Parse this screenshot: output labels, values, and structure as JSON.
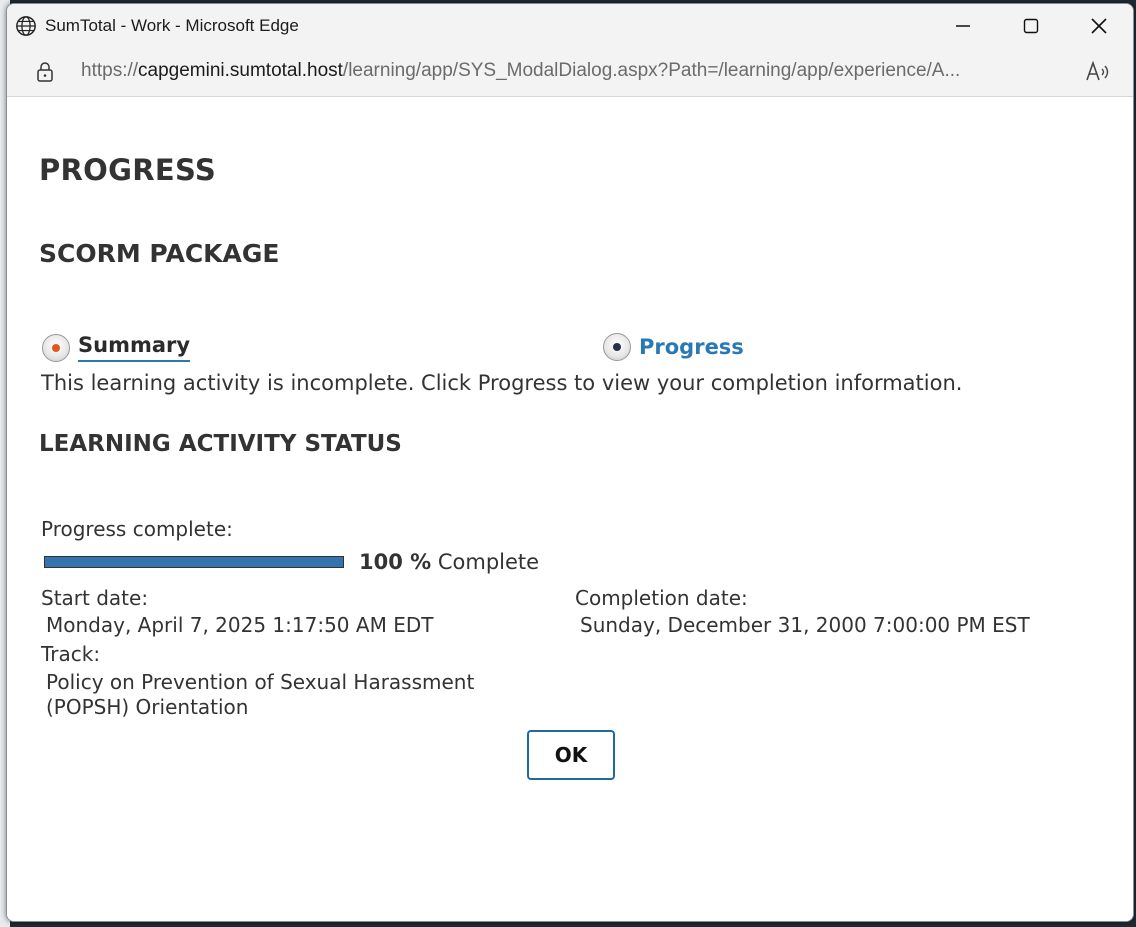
{
  "browser": {
    "window_title": "SumTotal - Work - Microsoft Edge",
    "url_scheme": "https://",
    "url_host": "capgemini.sumtotal.host",
    "url_path": "/learning/app/SYS_ModalDialog.aspx?Path=/learning/app/experience/A..."
  },
  "page": {
    "title": "PROGRESS",
    "subtitle": "SCORM PACKAGE",
    "tabs": [
      {
        "label": "Summary",
        "selected": true
      },
      {
        "label": "Progress",
        "selected": false
      }
    ],
    "description": "This learning activity is incomplete. Click Progress to view your completion information.",
    "status_heading": "LEARNING ACTIVITY STATUS",
    "progress_label": "Progress complete:",
    "progress_value": "100 %",
    "progress_fraction": 1.0,
    "progress_suffix": "Complete",
    "start_label": "Start date:",
    "start_value": "Monday, April 7, 2025 1:17:50 AM EDT",
    "completion_label": "Completion date:",
    "completion_value": "Sunday, December 31, 2000 7:00:00 PM EST",
    "track_label": "Track:",
    "track_line1": "Policy on Prevention of Sexual Harassment",
    "track_line2": "(POPSH) Orientation",
    "ok_label": "OK"
  },
  "colors": {
    "accent": "#2a79b5",
    "progress_fill": "#3473b0",
    "summary_dot": "#e2571e"
  },
  "icons": [
    "globe-icon",
    "minimize-icon",
    "maximize-icon",
    "close-icon",
    "lock-icon",
    "read-aloud-icon"
  ]
}
